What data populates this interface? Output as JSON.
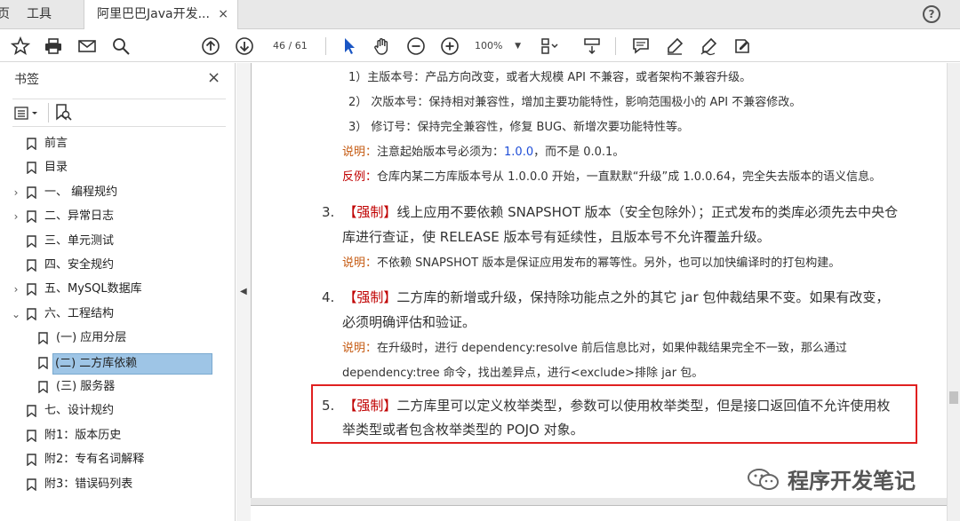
{
  "tabbar": {
    "home_label": "页",
    "tools_label": "工具",
    "doc_tab_label": "阿里巴巴Java开发...",
    "close_glyph": "×",
    "help_glyph": "?"
  },
  "toolbar": {
    "page_current": "46",
    "page_total": "/ 61",
    "zoom": "100%",
    "icons": [
      "star-icon",
      "print-icon",
      "mail-icon",
      "search-icon",
      "page-up-icon",
      "page-down-icon",
      "select-cursor-icon",
      "hand-tool-icon",
      "zoom-out-icon",
      "zoom-in-icon",
      "fit-page-icon",
      "scroll-mode-icon",
      "comment-icon",
      "highlight-icon",
      "sign-icon",
      "fill-sign-icon"
    ]
  },
  "sidebar": {
    "title": "书签",
    "close_glyph": "×",
    "items": [
      {
        "label": "前言",
        "expand": ""
      },
      {
        "label": "目录",
        "expand": ""
      },
      {
        "label": "一、 编程规约",
        "expand": "›"
      },
      {
        "label": "二、异常日志",
        "expand": "›"
      },
      {
        "label": "三、单元测试",
        "expand": ""
      },
      {
        "label": "四、安全规约",
        "expand": ""
      },
      {
        "label": "五、MySQL数据库",
        "expand": "›"
      },
      {
        "label": "六、工程结构",
        "expand": "⌄"
      },
      {
        "label": "(一) 应用分层",
        "expand": ""
      },
      {
        "label": "(二) 二方库依赖",
        "expand": ""
      },
      {
        "label": "(三) 服务器",
        "expand": ""
      },
      {
        "label": "七、设计规约",
        "expand": ""
      },
      {
        "label": "附1：版本历史",
        "expand": ""
      },
      {
        "label": "附2：专有名词解释",
        "expand": ""
      },
      {
        "label": "附3：错误码列表",
        "expand": ""
      }
    ]
  },
  "document": {
    "l1": "1）主版本号：产品方向改变，或者大规模 API 不兼容，或者架构不兼容升级。",
    "l2": "2） 次版本号：保持相对兼容性，增加主要功能特性，影响范围极小的 API 不兼容修改。",
    "l3": "3） 修订号：保持完全兼容性，修复 BUG、新增次要功能特性等。",
    "l4_note": "说明：",
    "l4_a": "注意起始版本号必须为：",
    "l4_b": "1.0.0",
    "l4_c": "，而不是 0.0.1。",
    "l5_note": "反例：",
    "l5_a": "仓库内某二方库版本号从 1.0.0.0 开始，一直默默“升级”成 1.0.0.64，完全失去版本的语义信息。",
    "i3_num": "3.",
    "i3_tag": "【强制】",
    "i3_a": "线上应用不要依赖 SNAPSHOT 版本（安全包除外）；正式发布的类库必须先去中央仓",
    "i3_b": "库进行查证，使 RELEASE 版本号有延续性，且版本号不允许覆盖升级。",
    "i3_note": "说明：",
    "i3_note_text": "不依赖 SNAPSHOT 版本是保证应用发布的幂等性。另外，也可以加快编译时的打包构建。",
    "i4_num": "4.",
    "i4_tag": "【强制】",
    "i4_a": "二方库的新增或升级，保持除功能点之外的其它 jar 包仲裁结果不变。如果有改变，",
    "i4_b": "必须明确评估和验证。",
    "i4_note": "说明：",
    "i4_note_a": "在升级时，进行 dependency:resolve 前后信息比对，如果仲裁结果完全不一致，那么通过",
    "i4_note_b": "dependency:tree 命令，找出差异点，进行<exclude>排除 jar 包。",
    "i5_num": "5.",
    "i5_tag": "【强制】",
    "i5_a": "二方库里可以定义枚举类型，参数可以使用枚举类型，但是接口返回值不允许使用枚",
    "i5_b": "举类型或者包含枚举类型的 POJO 对象。"
  },
  "watermark": {
    "text": "程序开发笔记"
  },
  "colors": {
    "note": "#c55a11",
    "warn": "#c00000",
    "highlight_box": "#e02020",
    "selection": "#9ec5e6"
  }
}
